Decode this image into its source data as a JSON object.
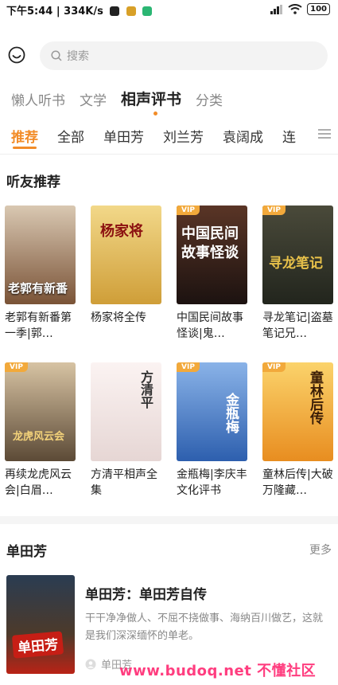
{
  "status_bar": {
    "time": "下午5:44",
    "speed": "334K/s",
    "battery": "100"
  },
  "search": {
    "placeholder": "搜索"
  },
  "categories": [
    "懒人听书",
    "文学",
    "相声评书",
    "分类"
  ],
  "subtabs": [
    "推荐",
    "全部",
    "单田芳",
    "刘兰芳",
    "袁阔成",
    "连"
  ],
  "section1": {
    "title": "听友推荐"
  },
  "books": [
    {
      "title": "老郭有新番第一季|郭…",
      "cover_text": "老郭有新番",
      "vip": "",
      "color": "#6a4a36"
    },
    {
      "title": "杨家将全传",
      "cover_text": "杨家将",
      "vip": "",
      "color": "#e8c56a"
    },
    {
      "title": "中国民间故事怪谈|鬼…",
      "cover_text": "中国民间故事怪谈",
      "vip": "VIP",
      "color": "#2b1a14"
    },
    {
      "title": "寻龙笔记|盗墓笔记兄…",
      "cover_text": "寻龙笔记",
      "vip": "VIP",
      "color": "#3a3a2c"
    },
    {
      "title": "再续龙虎风云会|白眉…",
      "cover_text": "龙虎风云会",
      "vip": "VIP",
      "color": "#6b5a44"
    },
    {
      "title": "方清平相声全集",
      "cover_text": "方清平",
      "vip": "",
      "color": "#f3e7e5"
    },
    {
      "title": "金瓶梅|李庆丰文化评书",
      "cover_text": "金瓶梅",
      "vip": "VIP",
      "color": "#2a67b6"
    },
    {
      "title": "童林后传|大破万隆藏…",
      "cover_text": "童林后传",
      "vip": "VIP",
      "color": "#f0a12a"
    }
  ],
  "section2": {
    "title": "单田芳",
    "more": "更多"
  },
  "featured": {
    "title": "单田芳：单田芳自传",
    "desc": "干干净净做人、不屈不挠做事、海纳百川做艺，这就是我们深深缅怀的单老。",
    "author": "单田芳",
    "cover_text": "单田芳"
  },
  "watermark": "www.budoq.net 不懂社区"
}
